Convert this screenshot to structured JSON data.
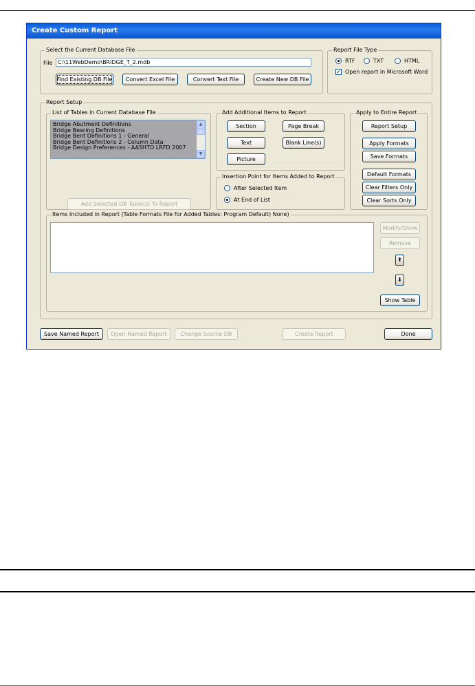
{
  "window": {
    "title": "Create Custom Report"
  },
  "db_group": {
    "legend": "Select the Current Database File",
    "file_label": "File",
    "file_value": "C:\\11WebDemo\\BRIDGE_T_2.mdb",
    "buttons": [
      "Find Existing DB File",
      "Convert Excel File",
      "Convert Text File",
      "Create New DB File"
    ]
  },
  "file_type": {
    "legend": "Report File Type",
    "options": [
      "RTF",
      "TXT",
      "HTML"
    ],
    "selected": "RTF",
    "open_word_label": "Open report in Microsoft Word",
    "open_word_checked": true
  },
  "report_setup": {
    "legend": "Report Setup",
    "tables_legend": "List of Tables in Current Database File",
    "tables": [
      "Bridge Abutment Definitions",
      "Bridge Bearing Definitions",
      "Bridge Bent Definitions 1 - General",
      "Bridge Bent Definitions 2 - Column Data",
      "Bridge Design Preferences - AASHTO LRFD 2007"
    ],
    "add_tables_button": "Add Selected DB Table(s) To Report",
    "add_items": {
      "legend": "Add Additional Items to Report",
      "section": "Section",
      "page_break": "Page Break",
      "text": "Text",
      "blank_lines": "Blank Line(s)",
      "picture": "Picture"
    },
    "insertion": {
      "legend": "Insertion Point for Items Added to Report",
      "after_selected": "After Selected Item",
      "end_of_list": "At End of List",
      "selected": "end"
    },
    "apply_entire": {
      "legend": "Apply to Entire Report",
      "report_setup": "Report Setup",
      "apply_formats": "Apply Formats",
      "save_formats": "Save Formats",
      "default_formats": "Default Formats",
      "clear_filters": "Clear Filters Only",
      "clear_sorts": "Clear Sorts Only"
    },
    "items": {
      "legend": "Items Included in Report   (Table Formats File for Added Tables:  Program Default)  None)",
      "modify_show": "Modify/Show",
      "remove": "Remove",
      "show_table": "Show Table"
    }
  },
  "footer": {
    "save_named": "Save Named Report",
    "open_named": "Open Named Report",
    "change_source": "Change Source DB",
    "create_report": "Create Report",
    "done": "Done"
  }
}
